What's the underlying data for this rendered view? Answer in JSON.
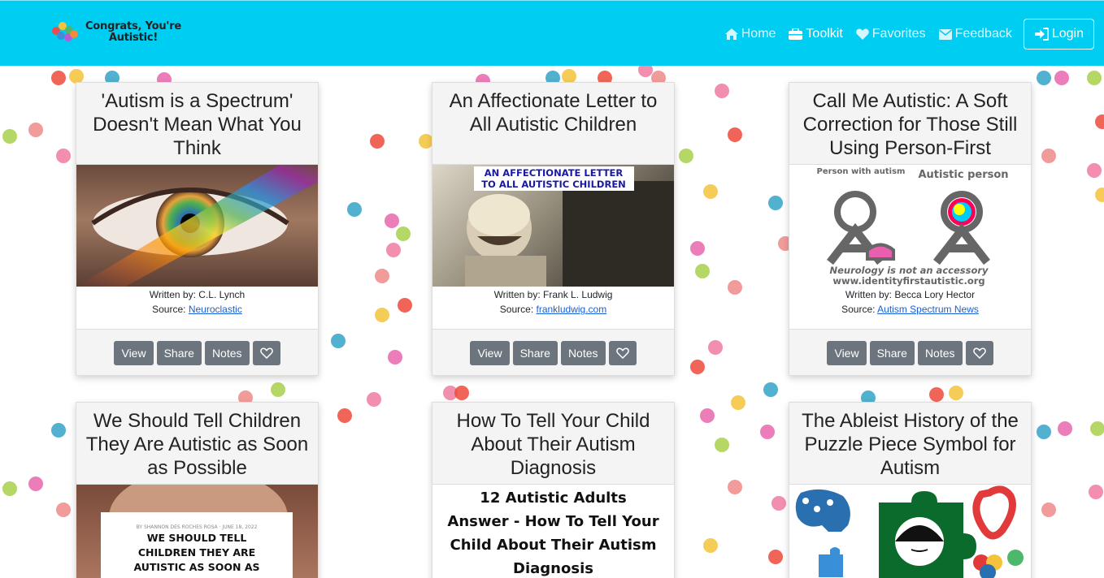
{
  "brand": {
    "line1": "Congrats, You're",
    "line2": "Autistic!"
  },
  "nav": {
    "home": "Home",
    "toolkit": "Toolkit",
    "favorites": "Favorites",
    "feedback": "Feedback",
    "login": "Login"
  },
  "buttons": {
    "view": "View",
    "share": "Share",
    "notes": "Notes"
  },
  "labels": {
    "written_by": "Written by:",
    "source": "Source:"
  },
  "cards": [
    {
      "title": "'Autism is a Spectrum' Doesn't Mean What You Think",
      "author": "C.L. Lynch",
      "source": "Neuroclastic"
    },
    {
      "title": "An Affectionate Letter to All Autistic Children",
      "author": "Frank L. Ludwig",
      "source": "frankludwig.com",
      "image_caption_1": "AN AFFECTIONATE LETTER",
      "image_caption_2": "TO ALL AUTISTIC CHILDREN"
    },
    {
      "title": "Call Me Autistic: A Soft Correction for Those Still Using Person-First",
      "author": "Becca Lory Hector",
      "source": "Autism Spectrum News",
      "image_left": "Person with autism",
      "image_right": "Autistic person",
      "image_caption_1": "Neurology is not an accessory",
      "image_caption_2": "www.identityfirstautistic.org"
    },
    {
      "title": "We Should Tell Children They Are Autistic as Soon as Possible",
      "image_byline": "BY SHANNON DES ROCHES ROSA · JUNE 18, 2022",
      "image_text": "WE SHOULD TELL CHILDREN THEY ARE AUTISTIC AS SOON AS"
    },
    {
      "title": "How To Tell Your Child About Their Autism Diagnosis",
      "image_text": "12 Autistic Adults Answer - How To Tell Your Child About Their Autism Diagnosis"
    },
    {
      "title": "The Ableist History of the Puzzle Piece Symbol for Autism"
    }
  ],
  "colors": {
    "navbar": "#00cdf2",
    "button": "#6c757d",
    "link": "#1a5fd6"
  }
}
